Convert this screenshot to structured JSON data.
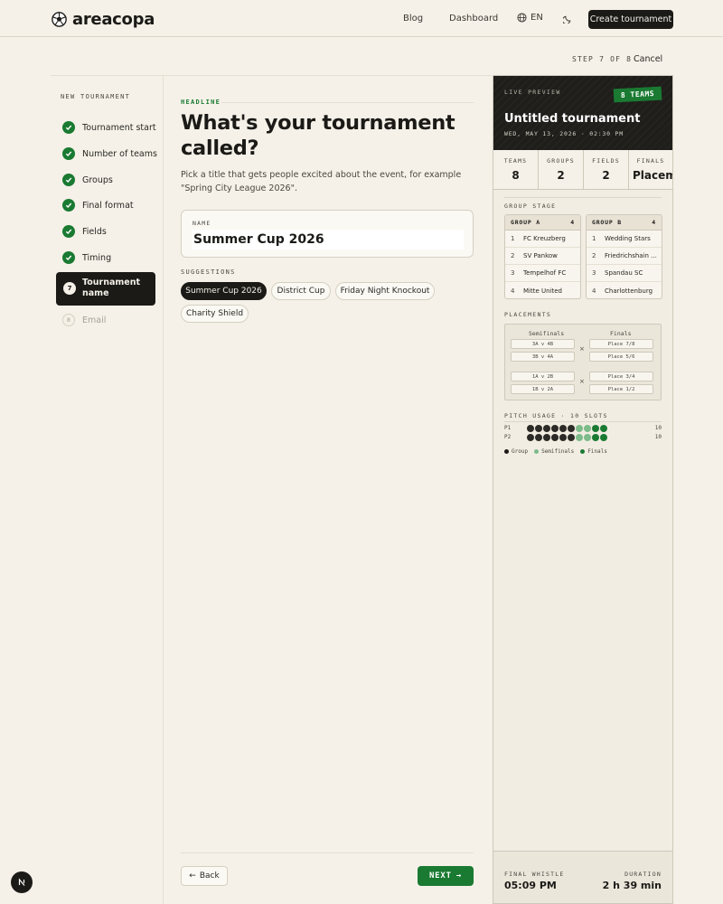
{
  "header": {
    "brand": "areacopa",
    "nav": [
      "Blog",
      "Dashboard"
    ],
    "language": "EN",
    "cta": "Create tournament"
  },
  "progress": {
    "step_text": "STEP 7 OF 8",
    "cancel": "Cancel"
  },
  "sidebar": {
    "title": "NEW TOURNAMENT",
    "done_steps": [
      "Tournament start",
      "Number of teams",
      "Groups",
      "Final format",
      "Fields",
      "Timing"
    ],
    "active_step": {
      "number": "7",
      "label": "Tournament name"
    },
    "pending_step": {
      "number": "8",
      "label": "Email"
    }
  },
  "main": {
    "eyebrow": "HEADLINE",
    "headline": "What's your tournament called?",
    "description": "Pick a title that gets people excited about the event, for example \"Spring City League 2026\".",
    "name_label": "NAME",
    "name_value": "Summer Cup 2026",
    "suggestions_title": "SUGGESTIONS",
    "suggestions": [
      "Summer Cup 2026",
      "District Cup",
      "Friday Night Knockout",
      "Charity Shield"
    ],
    "selected_suggestion": "Summer Cup 2026",
    "back": "Back",
    "next": "NEXT"
  },
  "preview": {
    "live_label": "LIVE PREVIEW",
    "teams_badge": "8 TEAMS",
    "title": "Untitled tournament",
    "date": "WED, MAY 13, 2026 · 02:30 PM",
    "stats": [
      {
        "label": "TEAMS",
        "value": "8"
      },
      {
        "label": "GROUPS",
        "value": "2"
      },
      {
        "label": "FIELDS",
        "value": "2"
      },
      {
        "label": "FINALS",
        "value": "Placem"
      }
    ],
    "group_stage_title": "GROUP STAGE",
    "groups": [
      {
        "name": "GROUP A",
        "count": "4",
        "teams": [
          "FC Kreuzberg",
          "SV Pankow",
          "Tempelhof FC",
          "Mitte United"
        ]
      },
      {
        "name": "GROUP B",
        "count": "4",
        "teams": [
          "Wedding Stars",
          "Friedrichshain ...",
          "Spandau SC",
          "Charlottenburg"
        ]
      }
    ],
    "placements_title": "PLACEMENTS",
    "placements": {
      "semis_head": "Semifinals",
      "finals_head": "Finals",
      "semis": [
        "3A v 4B",
        "3B v 4A",
        "1A v 2B",
        "1B v 2A"
      ],
      "finals": [
        "Place 7/8",
        "Place 5/6",
        "Place 3/4",
        "Place 1/2"
      ]
    },
    "pitch_title": "PITCH USAGE · 10 SLOTS",
    "pitch_rows": [
      {
        "label": "P1",
        "count": "10",
        "slots": [
          "group",
          "group",
          "group",
          "group",
          "group",
          "group",
          "semi",
          "semi",
          "final",
          "final"
        ]
      },
      {
        "label": "P2",
        "count": "10",
        "slots": [
          "group",
          "group",
          "group",
          "group",
          "group",
          "group",
          "semi",
          "semi",
          "final",
          "final"
        ]
      }
    ],
    "legend": [
      "Group",
      "Semifinals",
      "Finals"
    ],
    "slot_colors": {
      "group": "#2b2a26",
      "semi": "#7dbb8a",
      "final": "#1a7a32"
    },
    "final_whistle_label": "FINAL WHISTLE",
    "final_whistle": "05:09 PM",
    "duration_label": "DURATION",
    "duration": "2 h 39 min"
  },
  "colors": {
    "accent": "#1a7a32",
    "dark": "#1b1a17",
    "background": "#f5f1e8"
  }
}
